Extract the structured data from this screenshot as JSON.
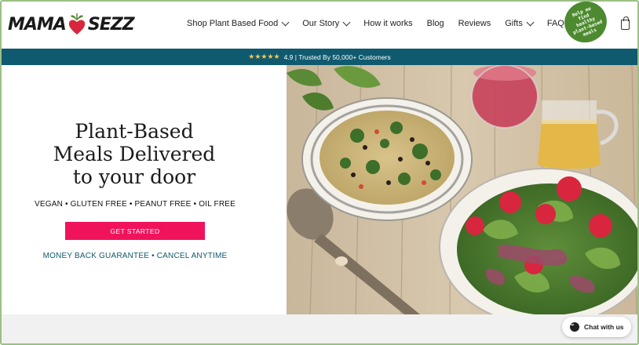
{
  "brand": {
    "name_left": "MAMA",
    "name_right": "SEZZ"
  },
  "nav": {
    "items": [
      {
        "label": "Shop Plant Based Food",
        "has_dropdown": true
      },
      {
        "label": "Our Story",
        "has_dropdown": true
      },
      {
        "label": "How it works",
        "has_dropdown": false
      },
      {
        "label": "Blog",
        "has_dropdown": false
      },
      {
        "label": "Reviews",
        "has_dropdown": false
      },
      {
        "label": "Gifts",
        "has_dropdown": true
      },
      {
        "label": "FAQ|Conta",
        "has_dropdown": false
      }
    ],
    "help_badge": "Help me find healthy plant-based meals",
    "cart_icon": "shopping-bag-icon"
  },
  "announcement": {
    "stars": "★★★★★",
    "text": "4.9 | Trusted By 50,000+ Customers"
  },
  "hero": {
    "title_line1": "Plant-Based",
    "title_line2": "Meals Delivered",
    "title_line3": "to your door",
    "tags": "VEGAN • GLUTEN FREE • PEANUT FREE • OIL FREE",
    "cta_label": "GET STARTED",
    "guarantee": "MONEY BACK GUARANTEE • CANCEL ANYTIME"
  },
  "chat": {
    "label": "Chat with us"
  },
  "colors": {
    "teal": "#0f5a6e",
    "cta_pink": "#f0135c",
    "badge_green": "#4d8a2f",
    "star_gold": "#f5c65a",
    "beet_red": "#d7263d"
  }
}
